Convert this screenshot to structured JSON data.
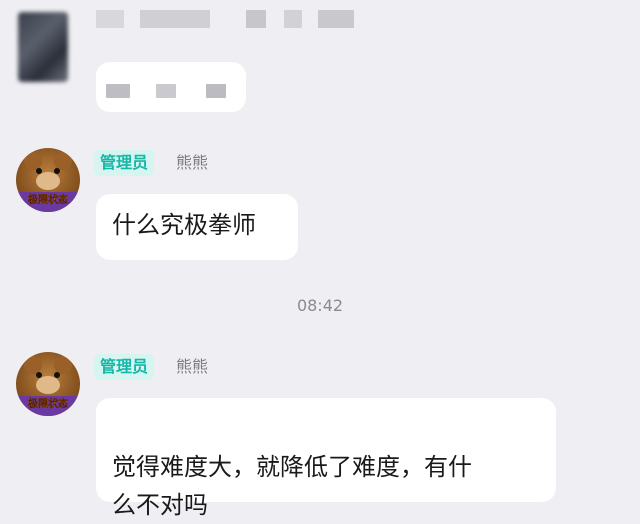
{
  "messages": [
    {
      "role": "管理员",
      "nickname": "熊熊",
      "avatar_text": "极限状态",
      "text": "什么究极拳师"
    },
    {
      "role": "管理员",
      "nickname": "熊熊",
      "avatar_text": "极限状态",
      "text": "觉得难度大，就降低了难度，有什\n么不对吗"
    }
  ],
  "timestamp": "08:42",
  "colors": {
    "background": "#efeff3",
    "bubble": "#ffffff",
    "role_badge_bg": "#d6f5f1",
    "role_badge_text": "#16b7a6"
  }
}
